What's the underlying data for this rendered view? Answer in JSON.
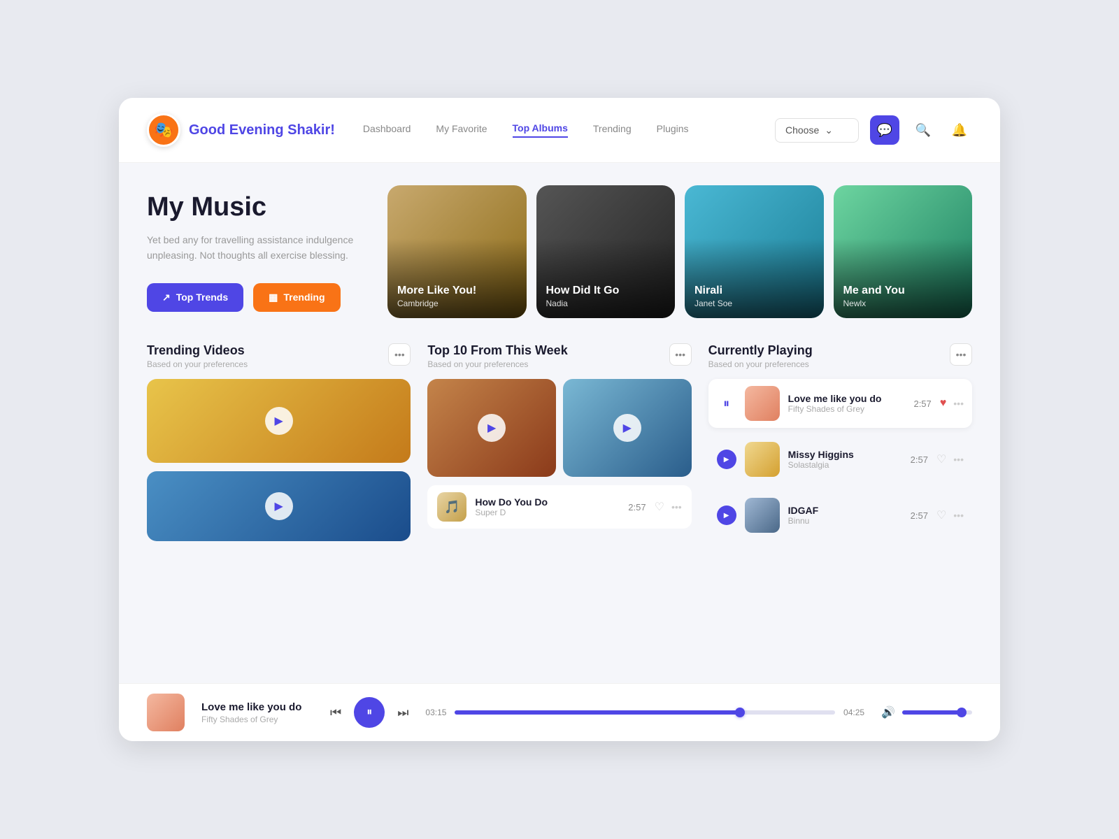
{
  "header": {
    "greeting": "Good Evening Shakir!",
    "avatar_emoji": "🎭",
    "nav_items": [
      {
        "label": "Dashboard",
        "active": false
      },
      {
        "label": "My Favorite",
        "active": false
      },
      {
        "label": "Top Albums",
        "active": true
      },
      {
        "label": "Trending",
        "active": false
      },
      {
        "label": "Plugins",
        "active": false
      }
    ],
    "choose_label": "Choose",
    "chat_icon": "💬",
    "search_icon": "🔍",
    "bell_icon": "🔔"
  },
  "hero": {
    "title": "My Music",
    "description": "Yet bed any for travelling assistance indulgence unpleasing. Not thoughts all exercise blessing.",
    "btn_trends": "Top Trends",
    "btn_trending": "Trending",
    "albums": [
      {
        "title": "More Like You!",
        "artist": "Cambridge",
        "color": "card-1"
      },
      {
        "title": "How Did It Go",
        "artist": "Nadia",
        "color": "card-2"
      },
      {
        "title": "Nirali",
        "artist": "Janet Soe",
        "color": "card-3"
      },
      {
        "title": "Me and You",
        "artist": "Newlx",
        "color": "card-4"
      }
    ]
  },
  "trending_videos": {
    "title": "Trending Videos",
    "subtitle": "Based on your preferences"
  },
  "top10": {
    "title": "Top 10 From This Week",
    "subtitle": "Based on your preferences",
    "song": {
      "name": "How Do You Do",
      "artist": "Super D",
      "duration": "2:57"
    }
  },
  "currently_playing": {
    "title": "Currently Playing",
    "subtitle": "Based on your preferences",
    "songs": [
      {
        "title": "Love me like you do",
        "artist": "Fifty Shades of Grey",
        "duration": "2:57",
        "active": true,
        "liked": true
      },
      {
        "title": "Missy Higgins",
        "artist": "Solastalgia",
        "duration": "2:57",
        "active": false,
        "liked": false
      },
      {
        "title": "IDGAF",
        "artist": "Binnu",
        "duration": "2:57",
        "active": false,
        "liked": false
      }
    ]
  },
  "player": {
    "title": "Love me like you do",
    "artist": "Fifty Shades of Grey",
    "current_time": "03:15",
    "total_time": "04:25",
    "progress_percent": 75,
    "volume_percent": 85
  },
  "icons": {
    "play": "▶",
    "pause": "⏸",
    "prev": "⏮",
    "next": "⏭",
    "heart_filled": "♥",
    "heart_empty": "♡",
    "dots": "•••",
    "chevron_down": "⌄",
    "volume": "🔊",
    "trending_up": "↗",
    "bar_chart": "▦"
  }
}
